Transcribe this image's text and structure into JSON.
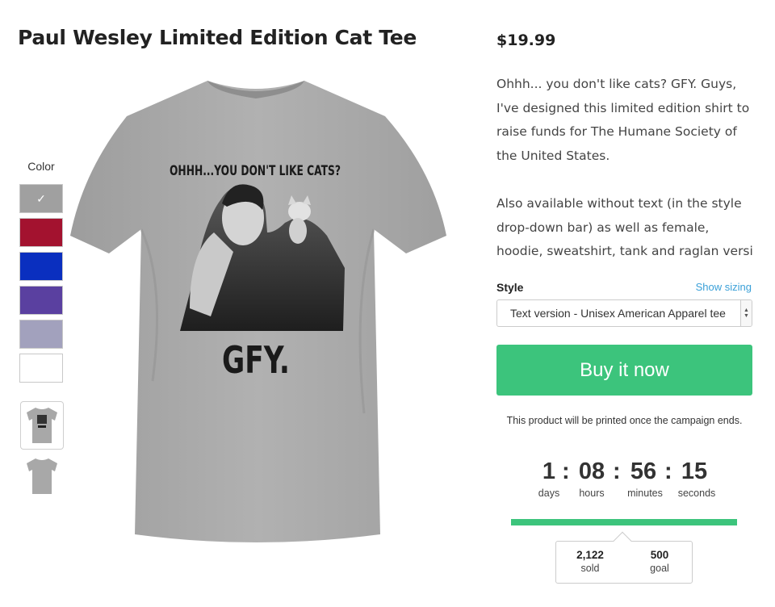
{
  "product": {
    "title": "Paul Wesley Limited Edition Cat Tee",
    "price": "$19.99",
    "description_p1": "Ohhh... you don't like cats? GFY. Guys, I've designed this limited edition shirt to raise funds for The Humane Society of the United States.",
    "description_p2": "Also available without text (in the style drop-down bar) as well as female, hoodie, sweatshirt, tank and raglan versi"
  },
  "shirt_print": {
    "headline": "OHHH...YOU DON'T LIKE CATS?",
    "footer": "GFY."
  },
  "color_picker": {
    "label": "Color",
    "selected_mark": "✓",
    "swatches": [
      {
        "name": "heather-grey",
        "color": "#a0a0a0",
        "selected": true
      },
      {
        "name": "cranberry",
        "color": "#a3122f",
        "selected": false
      },
      {
        "name": "royal-blue",
        "color": "#0a2fbf",
        "selected": false
      },
      {
        "name": "purple",
        "color": "#5a40a0",
        "selected": false
      },
      {
        "name": "lavender-grey",
        "color": "#a2a1bd",
        "selected": false
      },
      {
        "name": "white",
        "color": "#ffffff",
        "selected": false
      }
    ]
  },
  "style": {
    "label": "Style",
    "show_sizing": "Show sizing",
    "selected": "Text version - Unisex American Apparel tee"
  },
  "buy_button": "Buy it now",
  "print_note": "This product will be printed once the campaign ends.",
  "countdown": {
    "days": "1",
    "hours": "08",
    "minutes": "56",
    "seconds": "15",
    "days_label": "days",
    "hours_label": "hours",
    "minutes_label": "minutes",
    "seconds_label": "seconds"
  },
  "campaign": {
    "progress_fraction": 1.0,
    "sold": "2,122",
    "sold_label": "sold",
    "goal": "500",
    "goal_label": "goal"
  },
  "colors": {
    "accent_green": "#3cc47c",
    "link_blue": "#3aa0d8",
    "shirt_grey": "#a8a8a8"
  }
}
